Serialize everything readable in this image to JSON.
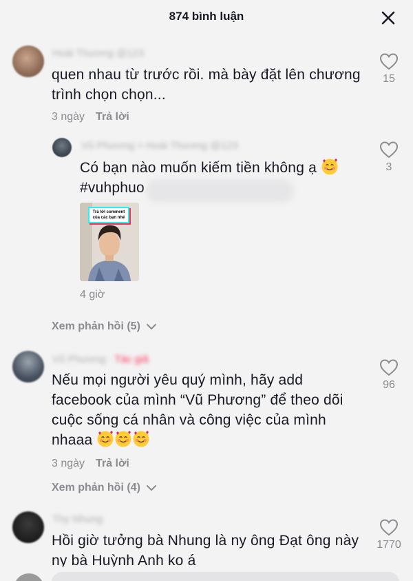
{
  "header": {
    "title": "874 bình luận"
  },
  "comments": [
    {
      "username": "Hoài Thương @123",
      "text": "quen nhau từ trước rồi. mà bày đặt lên chương trình chọn chọn...",
      "time": "3 ngày",
      "reply_label": "Trả lời",
      "likes": "15"
    },
    {
      "username": "Vũ Phương > Hoài Thương @123",
      "text": "Có bạn nào muốn kiếm tiền không ạ",
      "hashtag": "#vuhphuo",
      "thumb_caption": "Trả lời comment của các bạn nhé",
      "time": "4 giờ",
      "likes": "3"
    },
    {
      "view_replies": "Xem phản hồi (5)"
    },
    {
      "username": "Vũ Phương",
      "author_tag": "Tác giả",
      "text_lines": [
        "Nếu mọi người yêu quý mình, hãy add",
        "facebook của mình “Vũ Phương” để theo dõi",
        "cuộc sống cá nhân và công việc của mình",
        "nhaaa"
      ],
      "time": "3 ngày",
      "reply_label": "Trả lời",
      "likes": "96"
    },
    {
      "view_replies": "Xem phản hồi (4)"
    },
    {
      "username": "Thy Nhung",
      "text_lines": [
        "Hồi giờ tưởng bà Nhung là ny ông Đạt ông này",
        "ny bà Huỳnh Anh ko á"
      ],
      "likes": "1770"
    }
  ]
}
